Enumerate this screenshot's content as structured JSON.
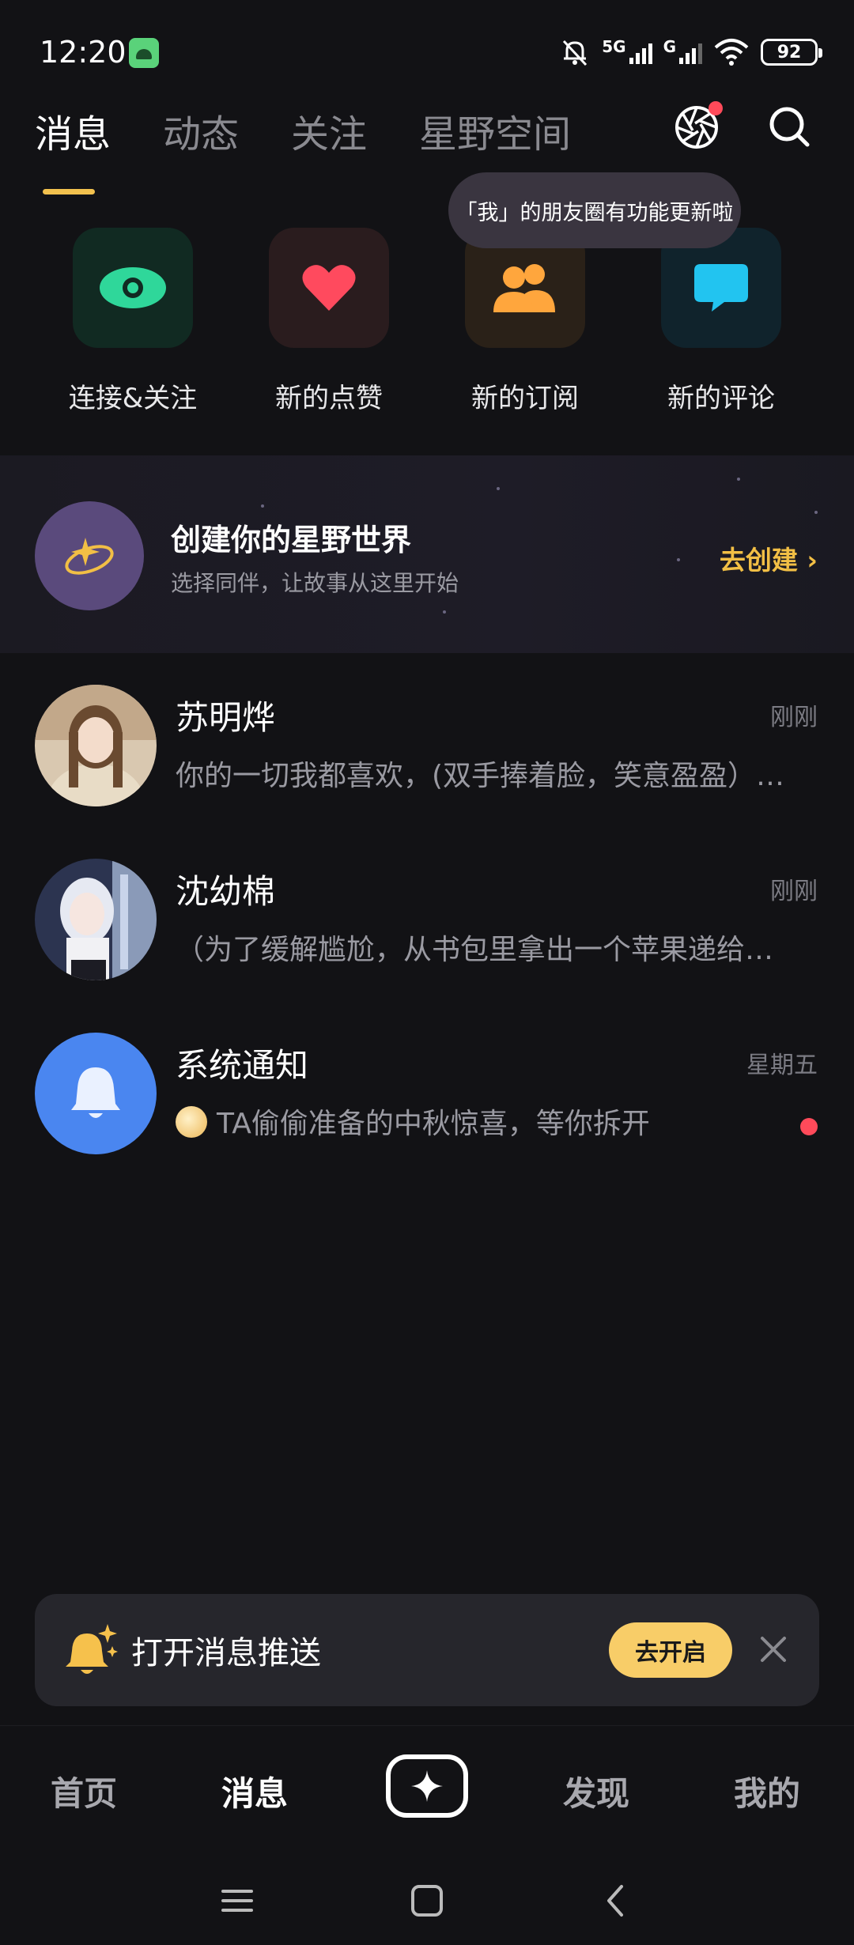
{
  "status_bar": {
    "time": "12:20",
    "network": "5G",
    "network2": "G",
    "battery": "92"
  },
  "top_tabs": [
    {
      "label": "消息",
      "active": true
    },
    {
      "label": "动态",
      "active": false
    },
    {
      "label": "关注",
      "active": false
    },
    {
      "label": "星野空间",
      "active": false
    }
  ],
  "tooltip": "「我」的朋友圈有功能更新啦",
  "quick_actions": [
    {
      "label": "连接&关注",
      "icon": "eye-icon",
      "bg": "#112a22",
      "color": "#2fd79a"
    },
    {
      "label": "新的点赞",
      "icon": "heart-icon",
      "bg": "#2a1c1e",
      "color": "#ff4a5e"
    },
    {
      "label": "新的订阅",
      "icon": "users-icon",
      "bg": "#2a2118",
      "color": "#ffa63d"
    },
    {
      "label": "新的评论",
      "icon": "comment-icon",
      "bg": "#10232c",
      "color": "#22c4f0"
    }
  ],
  "banner": {
    "title": "创建你的星野世界",
    "subtitle": "选择同伴，让故事从这里开始",
    "cta": "去创建 ›"
  },
  "chats": [
    {
      "name": "苏明烨",
      "time": "刚刚",
      "preview": "你的一切我都喜欢，(双手捧着脸，笑意盈盈）…",
      "avatar": "portrait-avatar"
    },
    {
      "name": "沈幼棉",
      "time": "刚刚",
      "preview": "（为了缓解尴尬，从书包里拿出一个苹果递给…",
      "avatar": "portrait-avatar"
    },
    {
      "name": "系统通知",
      "time": "星期五",
      "preview": "TA偷偷准备的中秋惊喜，等你拆开",
      "avatar": "bell-icon"
    }
  ],
  "notification_prompt": {
    "text": "打开消息推送",
    "button": "去开启"
  },
  "bottom_nav": [
    {
      "label": "首页",
      "active": false
    },
    {
      "label": "消息",
      "active": true
    },
    {
      "label": "发现",
      "active": false
    },
    {
      "label": "我的",
      "active": false
    }
  ],
  "colors": {
    "background": "#121215",
    "accent": "#f2c14e",
    "badge": "#ff4a5a"
  }
}
